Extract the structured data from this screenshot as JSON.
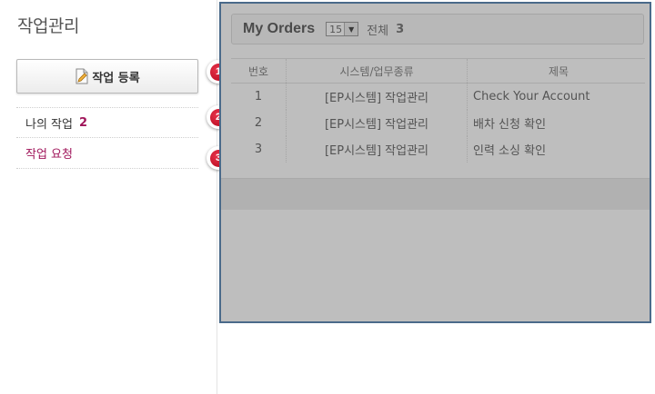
{
  "sidebar": {
    "title": "작업관리",
    "register_label": "작업 등록",
    "my_tasks_label": "나의 작업",
    "my_tasks_count": "2",
    "requests_label": "작업 요청"
  },
  "badges": [
    "1",
    "2",
    "3"
  ],
  "orders": {
    "title": "My Orders",
    "page_size": "15",
    "total_label": "전체",
    "total_count": "3",
    "columns": [
      "번호",
      "시스템/업무종류",
      "제목"
    ],
    "rows": [
      [
        "1",
        "[EP시스템] 작업관리",
        "Check Your Account"
      ],
      [
        "2",
        "[EP시스템] 작업관리",
        "배차 신청 확인"
      ],
      [
        "3",
        "[EP시스템] 작업관리",
        "인력 소싱 확인"
      ]
    ]
  },
  "colors": {
    "accent": "#a0155a",
    "panel_border": "#4a6a8a",
    "badge": "#c8102e"
  }
}
